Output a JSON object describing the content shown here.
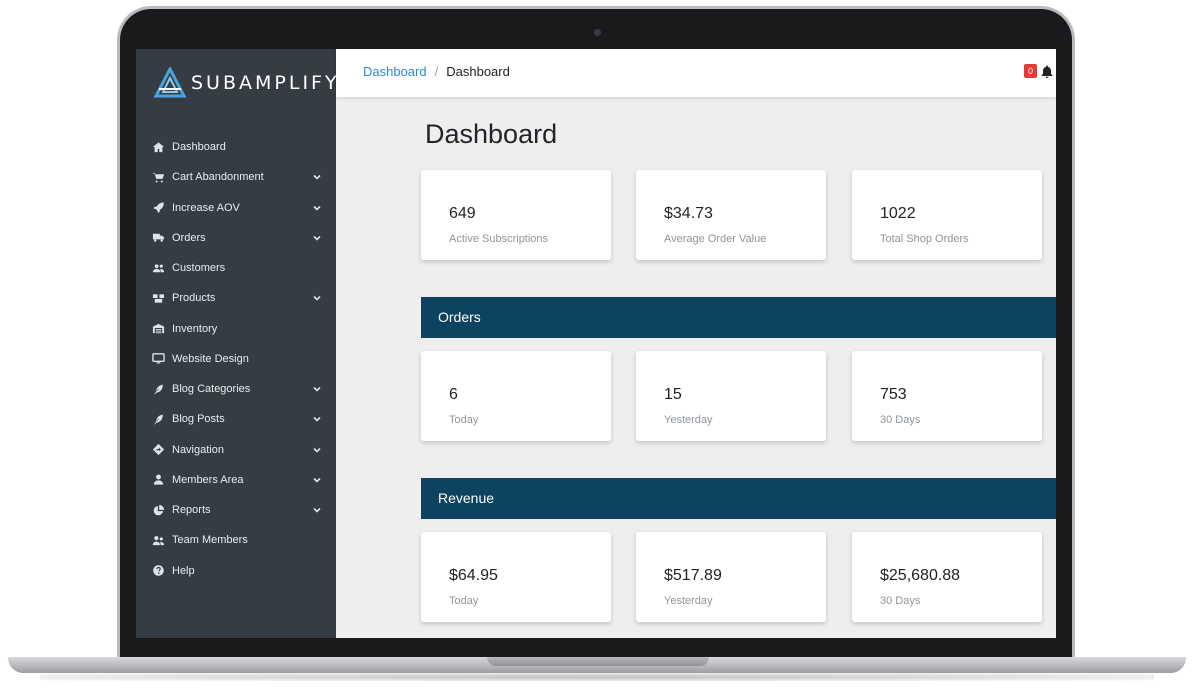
{
  "brand": {
    "name_part1": "SUB",
    "name_part2": "AMPLIFY"
  },
  "sidebar": {
    "items": [
      {
        "label": "Dashboard",
        "icon": "home-icon",
        "has_submenu": false
      },
      {
        "label": "Cart Abandonment",
        "icon": "cart-icon",
        "has_submenu": true
      },
      {
        "label": "Increase AOV",
        "icon": "rocket-icon",
        "has_submenu": true
      },
      {
        "label": "Orders",
        "icon": "truck-icon",
        "has_submenu": true
      },
      {
        "label": "Customers",
        "icon": "users-icon",
        "has_submenu": false
      },
      {
        "label": "Products",
        "icon": "boxes-icon",
        "has_submenu": true
      },
      {
        "label": "Inventory",
        "icon": "warehouse-icon",
        "has_submenu": false
      },
      {
        "label": "Website Design",
        "icon": "monitor-icon",
        "has_submenu": false
      },
      {
        "label": "Blog Categories",
        "icon": "feather-icon",
        "has_submenu": true
      },
      {
        "label": "Blog Posts",
        "icon": "feather-icon",
        "has_submenu": true
      },
      {
        "label": "Navigation",
        "icon": "directions-icon",
        "has_submenu": true
      },
      {
        "label": "Members Area",
        "icon": "user-icon",
        "has_submenu": true
      },
      {
        "label": "Reports",
        "icon": "pie-chart-icon",
        "has_submenu": true
      },
      {
        "label": "Team Members",
        "icon": "user-group-icon",
        "has_submenu": false
      },
      {
        "label": "Help",
        "icon": "question-circle-icon",
        "has_submenu": false
      }
    ]
  },
  "header": {
    "breadcrumb": {
      "link": "Dashboard",
      "separator": "/",
      "current": "Dashboard"
    },
    "notifications_count": "0"
  },
  "main": {
    "title": "Dashboard",
    "summary": [
      {
        "value": "649",
        "label": "Active Subscriptions"
      },
      {
        "value": "$34.73",
        "label": "Average Order Value"
      },
      {
        "value": "1022",
        "label": "Total Shop Orders"
      }
    ],
    "orders": {
      "title": "Orders",
      "cards": [
        {
          "value": "6",
          "label": "Today"
        },
        {
          "value": "15",
          "label": "Yesterday"
        },
        {
          "value": "753",
          "label": "30 Days"
        }
      ]
    },
    "revenue": {
      "title": "Revenue",
      "cards": [
        {
          "value": "$64.95",
          "label": "Today"
        },
        {
          "value": "$517.89",
          "label": "Yesterday"
        },
        {
          "value": "$25,680.88",
          "label": "30 Days"
        }
      ]
    }
  },
  "colors": {
    "sidebar": "#353c44",
    "section_header": "#0d4361",
    "link": "#2a8ccf",
    "badge": "#e53935"
  }
}
